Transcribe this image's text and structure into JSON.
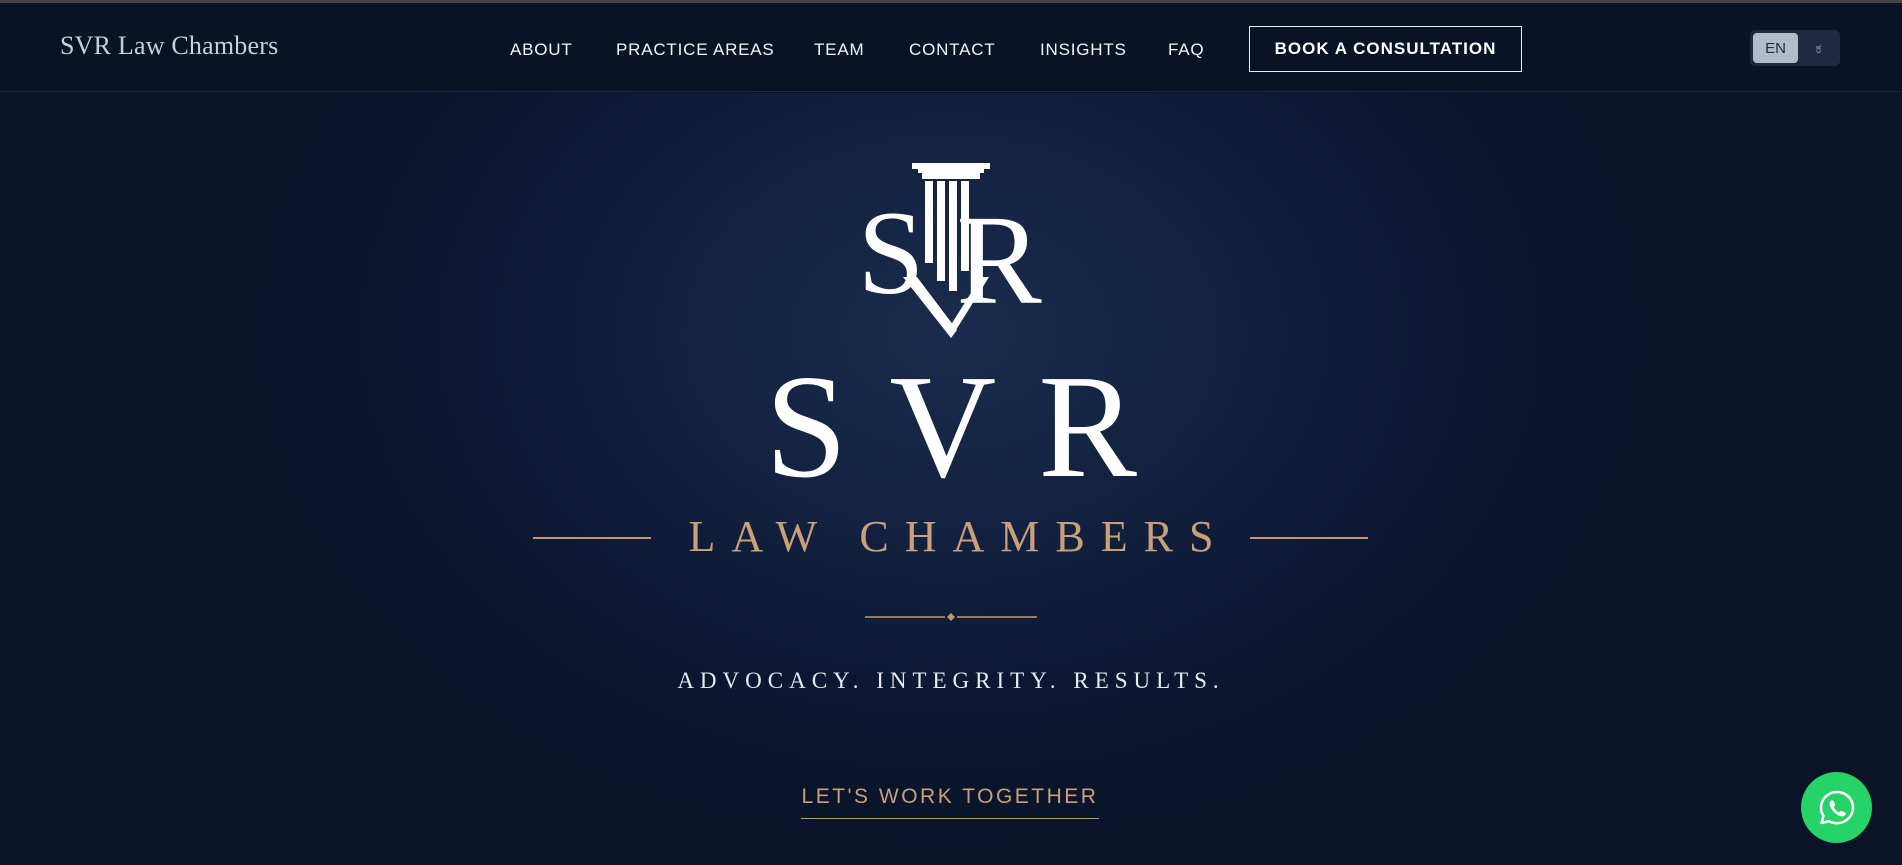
{
  "brand": {
    "name": "SVR Law Chambers"
  },
  "nav": {
    "items": [
      {
        "label": "ABOUT"
      },
      {
        "label": "PRACTICE AREAS"
      },
      {
        "label": "TEAM"
      },
      {
        "label": "CONTACT"
      },
      {
        "label": "INSIGHTS"
      },
      {
        "label": "FAQ"
      }
    ],
    "cta_label": "BOOK A CONSULTATION"
  },
  "language": {
    "options": [
      "EN",
      "ಕ"
    ],
    "selected": "EN"
  },
  "hero": {
    "logo_monogram": "SVR",
    "title": "SVR",
    "subtitle": "LAW CHAMBERS",
    "tagline": "ADVOCACY. INTEGRITY. RESULTS.",
    "cta_label": "LET'S WORK TOGETHER"
  },
  "floating": {
    "icon": "whatsapp-icon"
  },
  "colors": {
    "navy": "#0b1428",
    "gold": "#c9a079",
    "whatsapp_green": "#25d366"
  }
}
